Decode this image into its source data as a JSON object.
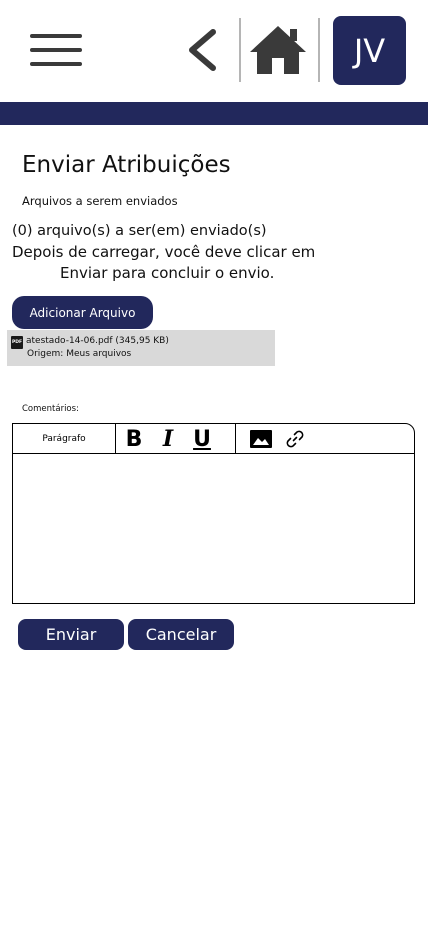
{
  "header": {
    "avatar_initials": "JV",
    "menu_icon": "hamburger-menu-icon",
    "back_icon": "chevron-left-icon",
    "home_icon": "home-icon"
  },
  "colors": {
    "brand": "#22285c",
    "file_background": "#d9d9d9"
  },
  "page": {
    "title": "Enviar Atribuições",
    "subtitle": "Arquivos a serem enviados",
    "file_count_text": "(0) arquivo(s) a ser(em) enviado(s)",
    "instruction_line1": "Depois de carregar, você deve clicar em",
    "instruction_line2": "Enviar para concluir o envio."
  },
  "upload": {
    "add_button_label": "Adicionar Arquivo",
    "files": [
      {
        "icon": "pdf-file-icon",
        "icon_text": "PDF",
        "name": "atestado-14-06.pdf (345,95 KB)",
        "origin": "Origem: Meus arquivos"
      }
    ]
  },
  "comments": {
    "label": "Comentários:",
    "toolbar": {
      "paragraph_label": "Parágrafo",
      "bold_label": "B",
      "italic_label": "I",
      "underline_label": "U",
      "image_icon": "image-icon",
      "link_icon": "link-icon"
    },
    "value": ""
  },
  "actions": {
    "submit_label": "Enviar",
    "cancel_label": "Cancelar"
  }
}
